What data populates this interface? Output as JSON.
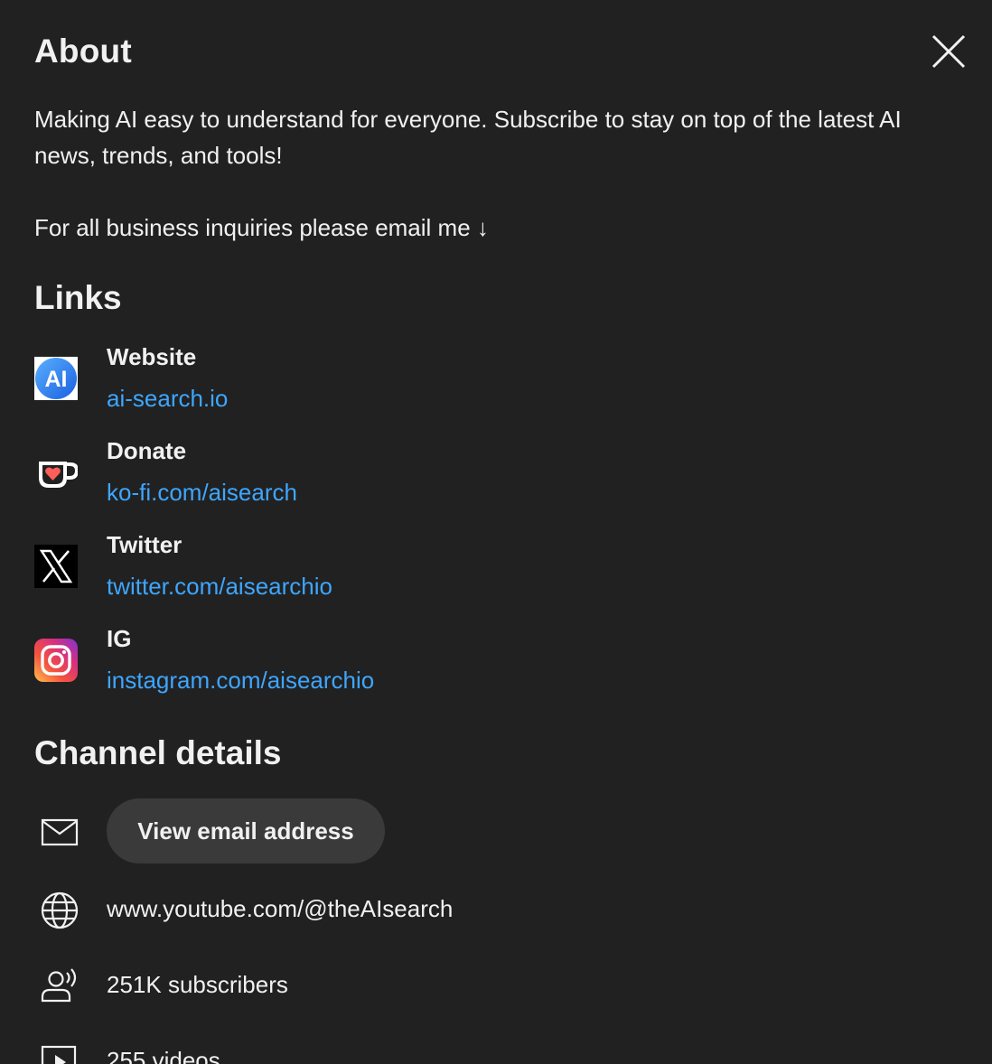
{
  "dialog": {
    "title": "About",
    "description": "Making AI easy to understand for everyone. Subscribe to stay on top of the latest AI news, trends, and tools!\n\nFor all business inquiries please email me ↓"
  },
  "links": {
    "heading": "Links",
    "items": [
      {
        "title": "Website",
        "url": "ai-search.io",
        "icon": "ai-search-logo-icon"
      },
      {
        "title": "Donate",
        "url": "ko-fi.com/aisearch",
        "icon": "kofi-cup-icon"
      },
      {
        "title": "Twitter",
        "url": "twitter.com/aisearchio",
        "icon": "x-logo-icon"
      },
      {
        "title": "IG",
        "url": "instagram.com/aisearchio",
        "icon": "instagram-logo-icon"
      }
    ]
  },
  "channel_details": {
    "heading": "Channel details",
    "email_button": "View email address",
    "channel_url": "www.youtube.com/@theAIsearch",
    "subscribers": "251K subscribers",
    "videos": "255 videos"
  },
  "colors": {
    "background": "#212121",
    "text": "#f1f1f1",
    "link": "#3ea6ff",
    "button_bg": "#3a3a3a"
  }
}
